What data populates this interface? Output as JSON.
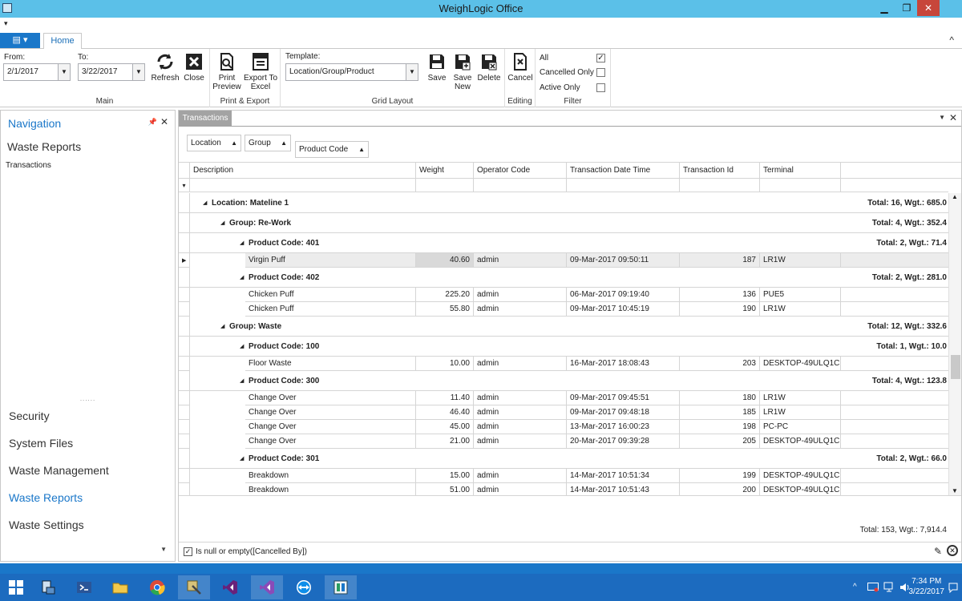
{
  "window": {
    "title": "WeighLogic Office",
    "min": "▁",
    "restore": "❐",
    "close": "✕"
  },
  "qat_glyph": "▾",
  "ribbon": {
    "app_button": "▤ ▾",
    "tab_home": "Home",
    "collapse_glyph": "^",
    "main": {
      "from_label": "From:",
      "from_value": "2/1/2017",
      "to_label": "To:",
      "to_value": "3/22/2017",
      "refresh": "Refresh",
      "close": "Close",
      "group": "Main"
    },
    "print": {
      "print_line1": "Print",
      "print_line2": "Preview",
      "export_line1": "Export To",
      "export_line2": "Excel",
      "group": "Print & Export"
    },
    "grid_layout": {
      "template_label": "Template:",
      "template_value": "Location/Group/Product",
      "save": "Save",
      "save_new_line1": "Save",
      "save_new_line2": "New",
      "delete": "Delete",
      "group": "Grid Layout"
    },
    "editing": {
      "cancel": "Cancel",
      "group": "Editing"
    },
    "filter": {
      "all": "All",
      "all_checked": "✓",
      "cancelled": "Cancelled Only",
      "active": "Active Only",
      "group": "Filter"
    }
  },
  "navigation": {
    "title": "Navigation",
    "pin": "📌",
    "close": "✕",
    "section": "Waste Reports",
    "items": [
      "Transactions"
    ],
    "grip": "......",
    "groups": [
      "Security",
      "System Files",
      "Waste Management",
      "Waste Reports",
      "Waste Settings"
    ],
    "active_group": "Waste Reports",
    "more": "▼"
  },
  "document": {
    "tab": "Transactions",
    "menu": "▼",
    "close": "✕",
    "group_chips": [
      "Location",
      "Group",
      "Product Code"
    ],
    "columns": [
      "Description",
      "Weight",
      "Operator Code",
      "Transaction Date Time",
      "Transaction Id",
      "Terminal"
    ],
    "filter_glyph": "▾",
    "groups": [
      {
        "level": 0,
        "label": "Location: Mateline 1",
        "total": "Total: 16,  Wgt.: 685.0"
      },
      {
        "level": 1,
        "label": "Group: Re-Work",
        "total": "Total: 4,  Wgt.: 352.4"
      },
      {
        "level": 2,
        "label": "Product Code: 401",
        "total": "Total: 2,  Wgt.: 71.4"
      },
      {
        "level": 2,
        "label": "Product Code: 402",
        "total": "Total: 2,  Wgt.: 281.0"
      },
      {
        "level": 1,
        "label": "Group: Waste",
        "total": "Total: 12,  Wgt.: 332.6"
      },
      {
        "level": 2,
        "label": "Product Code: 100",
        "total": "Total: 1,  Wgt.: 10.0"
      },
      {
        "level": 2,
        "label": "Product Code: 300",
        "total": "Total: 4,  Wgt.: 123.8"
      },
      {
        "level": 2,
        "label": "Product Code: 301",
        "total": "Total: 2,  Wgt.: 66.0"
      }
    ],
    "rows": [
      {
        "desc": "Virgin Puff",
        "weight": "40.60",
        "op": "admin",
        "dt": "09-Mar-2017 09:50:11",
        "id": "187",
        "term": "LR1W"
      },
      {
        "desc": "Chicken Puff",
        "weight": "225.20",
        "op": "admin",
        "dt": "06-Mar-2017 09:19:40",
        "id": "136",
        "term": "PUE5"
      },
      {
        "desc": "Chicken Puff",
        "weight": "55.80",
        "op": "admin",
        "dt": "09-Mar-2017 10:45:19",
        "id": "190",
        "term": "LR1W"
      },
      {
        "desc": "Floor Waste",
        "weight": "10.00",
        "op": "admin",
        "dt": "16-Mar-2017 18:08:43",
        "id": "203",
        "term": "DESKTOP-49ULQ1C"
      },
      {
        "desc": "Change Over",
        "weight": "11.40",
        "op": "admin",
        "dt": "09-Mar-2017 09:45:51",
        "id": "180",
        "term": "LR1W"
      },
      {
        "desc": "Change Over",
        "weight": "46.40",
        "op": "admin",
        "dt": "09-Mar-2017 09:48:18",
        "id": "185",
        "term": "LR1W"
      },
      {
        "desc": "Change Over",
        "weight": "45.00",
        "op": "admin",
        "dt": "13-Mar-2017 16:00:23",
        "id": "198",
        "term": "PC-PC"
      },
      {
        "desc": "Change Over",
        "weight": "21.00",
        "op": "admin",
        "dt": "20-Mar-2017 09:39:28",
        "id": "205",
        "term": "DESKTOP-49ULQ1C"
      },
      {
        "desc": "Breakdown",
        "weight": "15.00",
        "op": "admin",
        "dt": "14-Mar-2017 10:51:34",
        "id": "199",
        "term": "DESKTOP-49ULQ1C"
      },
      {
        "desc": "Breakdown",
        "weight": "51.00",
        "op": "admin",
        "dt": "14-Mar-2017 10:51:43",
        "id": "200",
        "term": "DESKTOP-49ULQ1C"
      }
    ],
    "current_row_glyph": "▶",
    "expand_glyph": "◢",
    "scroll_up": "▲",
    "scroll_down": "▼",
    "grand_total": "Total: 153, Wgt.: 7,914.4",
    "filter_text": "Is null or empty([Cancelled By])",
    "filter_checked": "✓",
    "filter_edit": "✎",
    "filter_clear": "✕"
  },
  "taskbar": {
    "clock_time": "7:34 PM",
    "clock_date": "3/22/2017",
    "tray_arrow": "^",
    "colors": {
      "taskbar": "#1c6bbf",
      "accent": "#1a77c9"
    }
  }
}
